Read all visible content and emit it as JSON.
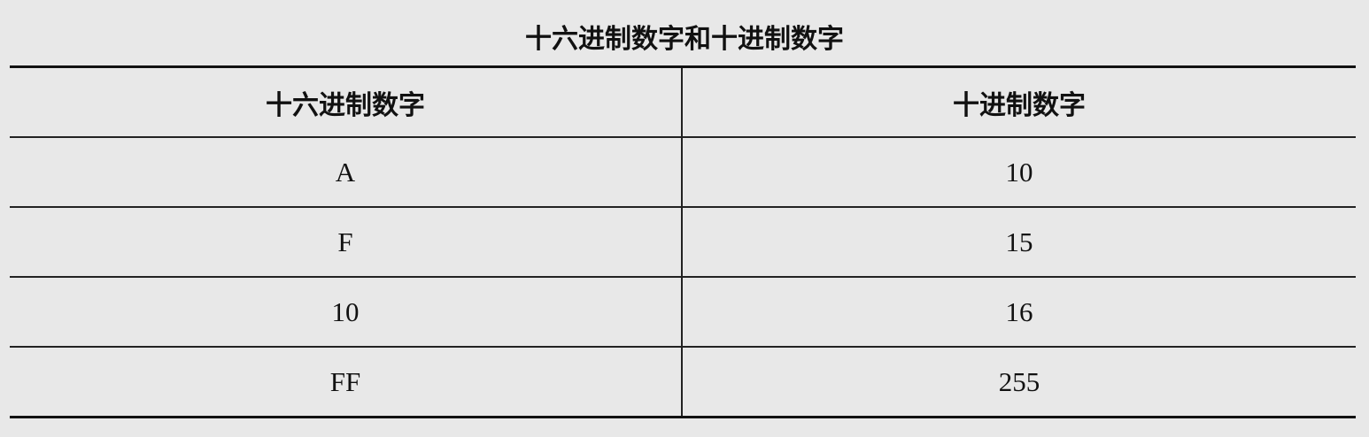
{
  "title": "十六进制数字和十进制数字",
  "headers": {
    "hex": "十六进制数字",
    "dec": "十进制数字"
  },
  "rows": [
    {
      "hex": "A",
      "dec": "10"
    },
    {
      "hex": "F",
      "dec": "15"
    },
    {
      "hex": "10",
      "dec": "16"
    },
    {
      "hex": "FF",
      "dec": "255"
    }
  ]
}
